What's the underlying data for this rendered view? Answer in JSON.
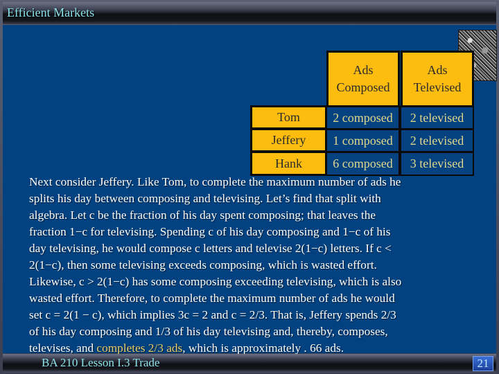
{
  "header": {
    "title": "Efficient Markets"
  },
  "table": {
    "columns": [
      "Ads\nComposed",
      "Ads\nTelevised"
    ],
    "column_lines": [
      [
        "Ads",
        "Composed"
      ],
      [
        "Ads",
        "Televised"
      ]
    ],
    "rows": [
      {
        "name": "Tom",
        "composed": "2 composed",
        "televised": "2 televised"
      },
      {
        "name": "Jeffery",
        "composed": "1 composed",
        "televised": "2 televised"
      },
      {
        "name": "Hank",
        "composed": "6 composed",
        "televised": "3 televised"
      }
    ]
  },
  "body": {
    "lines": [
      "Next consider Jeffery. Like Tom, to complete the maximum number of ads he",
      "splits his day between composing and televising. Let’s find that split with",
      "algebra. Let c be the fraction of his day spent composing; that leaves the",
      "fraction 1−c for televising. Spending c of his day composing and 1−c of his",
      "day televising, he would compose c letters and televise 2(1−c) letters. If c <",
      "2(1−c), then some televising exceeds composing, which is wasted effort.",
      "Likewise, c > 2(1−c) has some composing exceeding televising, which is also",
      "wasted effort. Therefore, to complete the maximum number of ads he would",
      "set c = 2(1 − c), which implies 3c = 2 and c = 2/3. That is, Jeffery spends 2/3",
      "of his day composing and 1/3 of his day televising and, thereby, composes,"
    ],
    "last_line_before": "televises, and ",
    "last_line_highlight": "completes 2/3 ads",
    "last_line_after": ", which is approximately . 66 ads."
  },
  "colors": {
    "background": "#034280",
    "gold": "#fdbd0f",
    "highlight": "#e9d06a",
    "title": "#8ee3ea"
  },
  "footer": {
    "course": "BA 210  Lesson I.3 Trade",
    "page": "21"
  }
}
